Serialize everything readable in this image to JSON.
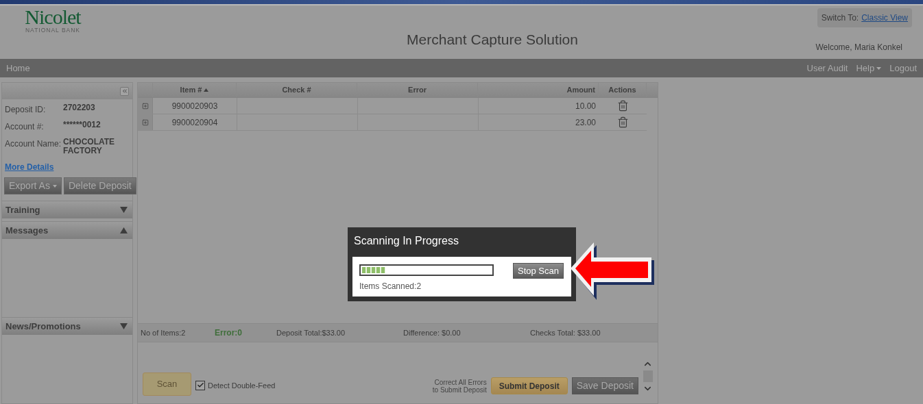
{
  "header": {
    "logo_name": "Nicolet",
    "logo_subtitle": "NATIONAL BANK",
    "title": "Merchant Capture Solution",
    "switch_label": "Switch To:",
    "switch_link": "Classic View",
    "welcome": "Welcome, Maria Konkel"
  },
  "nav": {
    "left": [
      {
        "label": "Home"
      }
    ],
    "right": [
      {
        "label": "User Audit",
        "dropdown": false
      },
      {
        "label": "Help",
        "dropdown": true
      },
      {
        "label": "Logout",
        "dropdown": false
      }
    ]
  },
  "sidebar": {
    "details": [
      {
        "label": "Deposit ID:",
        "value": "2702203"
      },
      {
        "label": "Account #:",
        "value": "******0012"
      },
      {
        "label": "Account Name:",
        "value": "CHOCOLATE FACTORY"
      }
    ],
    "more_details": "More Details",
    "buttons": [
      {
        "label": "Export As",
        "dropdown": true
      },
      {
        "label": "Delete Deposit",
        "dropdown": false
      }
    ],
    "sections": [
      {
        "title": "Training",
        "expanded": false
      },
      {
        "title": "Messages",
        "expanded": true
      },
      {
        "title": "News/Promotions",
        "expanded": false
      }
    ]
  },
  "table": {
    "columns": [
      {
        "label": "Item #",
        "sorted": true
      },
      {
        "label": "Check #",
        "sorted": false
      },
      {
        "label": "Error",
        "sorted": false
      },
      {
        "label": "Amount",
        "sorted": false
      },
      {
        "label": "Actions",
        "sorted": false
      }
    ],
    "rows": [
      {
        "item": "9900020903",
        "amount": "10.00"
      },
      {
        "item": "9900020904",
        "amount": "23.00"
      }
    ]
  },
  "summary": [
    {
      "text": "No of Items:2",
      "kind": "plain"
    },
    {
      "text": "Error:0",
      "kind": "status"
    },
    {
      "text": "Deposit Total:$33.00",
      "kind": "plain"
    },
    {
      "text": "Difference: $0.00",
      "kind": "plain"
    },
    {
      "text": "Checks Total: $33.00",
      "kind": "plain"
    }
  ],
  "footer": {
    "scan": {
      "label": "Scan",
      "disabled": true
    },
    "detect": {
      "label": "Detect Double-Feed",
      "checked": true
    },
    "hint": [
      "Correct All Errors",
      "to Submit Deposit"
    ],
    "submit": "Submit Deposit",
    "save": "Save Deposit"
  },
  "dialog": {
    "title": "Scanning In Progress",
    "level": 0.18,
    "items_scanned": "Items Scanned:2",
    "stop": "Stop Scan"
  }
}
